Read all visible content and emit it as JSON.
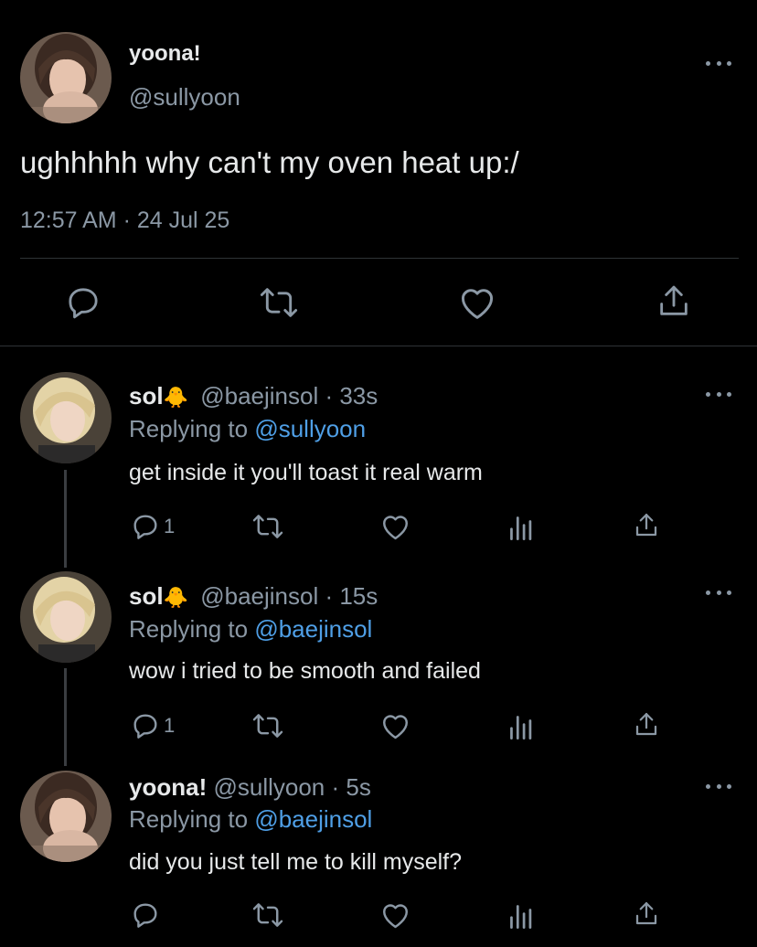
{
  "main_tweet": {
    "display_name": "yoona!",
    "handle": "@sullyoon",
    "text": "ughhhhh why can't my oven heat up:/",
    "timestamp": "12:57 AM · 24 Jul 25"
  },
  "replies": [
    {
      "display_name": "sol",
      "emoji": "🐥",
      "handle_time": "@baejinsol · 33s",
      "replying_prefix": "Replying to",
      "replying_to": "@sullyoon",
      "text": "get inside it you'll toast it real warm",
      "reply_count": "1"
    },
    {
      "display_name": "sol",
      "emoji": "🐥",
      "handle_time": "@baejinsol · 15s",
      "replying_prefix": "Replying to",
      "replying_to": "@baejinsol",
      "text": "wow i tried to be smooth and failed",
      "reply_count": "1"
    },
    {
      "display_name": "yoona!",
      "emoji": "",
      "handle_time": "@sullyoon · 5s",
      "replying_prefix": "Replying to",
      "replying_to": "@baejinsol",
      "text": "did you just tell me to kill myself?",
      "reply_count": ""
    }
  ],
  "colors": {
    "background": "#000000",
    "text": "#e7e9ea",
    "secondary": "#8b98a5",
    "link": "#4f9fe6"
  },
  "icons": {
    "reply": "speech-bubble-icon",
    "retweet": "retweet-icon",
    "like": "heart-icon",
    "views": "bar-chart-icon",
    "share": "share-icon",
    "more": "more-dots-icon"
  }
}
